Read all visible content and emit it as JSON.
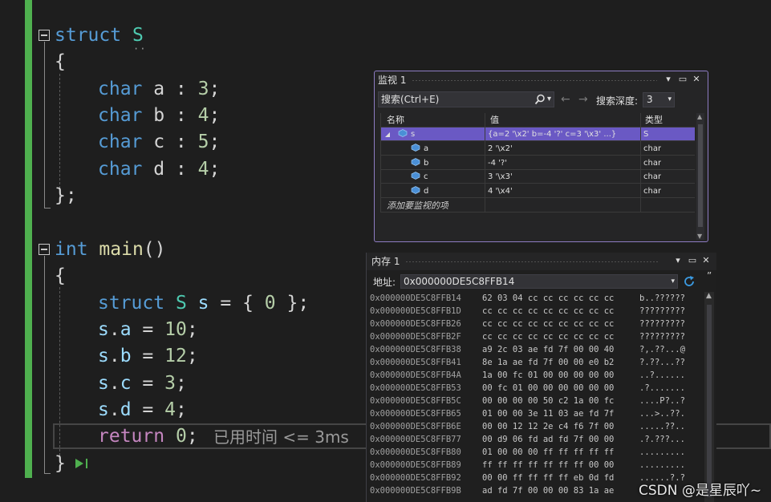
{
  "editor": {
    "lines": {
      "l1_kw": "struct",
      "l1_name": "S",
      "l2": "{",
      "l3_type": "char",
      "l3_rest": " a : ",
      "l3_num": "3",
      "l3_semi": ";",
      "l4_type": "char",
      "l4_rest": " b : ",
      "l4_num": "4",
      "l4_semi": ";",
      "l5_type": "char",
      "l5_rest": " c : ",
      "l5_num": "5",
      "l5_semi": ";",
      "l6_type": "char",
      "l6_rest": " d : ",
      "l6_num": "4",
      "l6_semi": ";",
      "l7": "};",
      "l8_kw": "int",
      "l8_fn": "main",
      "l8_rest": "()",
      "l9": "{",
      "l10_kw": "struct",
      "l10_ty": "S",
      "l10_var": "s",
      "l10_mid": " = { ",
      "l10_num": "0",
      "l10_end": " };",
      "l11_var": "s",
      "l11_dot": ".",
      "l11_mem": "a",
      "l11_eq": " = ",
      "l11_num": "10",
      "l11_semi": ";",
      "l12_var": "s",
      "l12_dot": ".",
      "l12_mem": "b",
      "l12_eq": " = ",
      "l12_num": "12",
      "l12_semi": ";",
      "l13_var": "s",
      "l13_dot": ".",
      "l13_mem": "c",
      "l13_eq": " = ",
      "l13_num": "3",
      "l13_semi": ";",
      "l14_var": "s",
      "l14_dot": ".",
      "l14_mem": "d",
      "l14_eq": " = ",
      "l14_num": "4",
      "l14_semi": ";",
      "l15_kw": "return",
      "l15_num": "0",
      "l15_semi": ";",
      "l16": "}"
    },
    "elapsed_text": "已用时间 <= 3ms",
    "colors": {
      "keyword": "#569cd6",
      "type": "#4ec9b0",
      "number": "#b5cea8",
      "return": "#c586c0",
      "change_bar": "#4fb04f"
    }
  },
  "watch": {
    "title": "监视 1",
    "search_placeholder": "搜索(Ctrl+E)",
    "depth_label": "搜索深度:",
    "depth_value": "3",
    "columns": {
      "name": "名称",
      "value": "值",
      "type": "类型"
    },
    "rows": [
      {
        "name": "s",
        "value": "{a=2 '\\x2' b=-4 '?' c=3 '\\x3' ...}",
        "type": "S"
      },
      {
        "name": "a",
        "value": "2 '\\x2'",
        "type": "char"
      },
      {
        "name": "b",
        "value": "-4 '?'",
        "type": "char"
      },
      {
        "name": "c",
        "value": "3 '\\x3'",
        "type": "char"
      },
      {
        "name": "d",
        "value": "4 '\\x4'",
        "type": "char"
      }
    ],
    "add_item": "添加要监视的项",
    "accent": "#6a59c4"
  },
  "memory": {
    "title": "内存 1",
    "address_label": "地址:",
    "address_value": "0x000000DE5C8FFB14",
    "rows": [
      {
        "addr": "0x000000DE5C8FFB14",
        "bytes": "62 03 04 cc cc cc cc cc cc",
        "ascii": "b..??????"
      },
      {
        "addr": "0x000000DE5C8FFB1D",
        "bytes": "cc cc cc cc cc cc cc cc cc",
        "ascii": "?????????"
      },
      {
        "addr": "0x000000DE5C8FFB26",
        "bytes": "cc cc cc cc cc cc cc cc cc",
        "ascii": "?????????"
      },
      {
        "addr": "0x000000DE5C8FFB2F",
        "bytes": "cc cc cc cc cc cc cc cc cc",
        "ascii": "?????????"
      },
      {
        "addr": "0x000000DE5C8FFB38",
        "bytes": "a9 2c 03 ae fd 7f 00 00 40",
        "ascii": "?,.??...@"
      },
      {
        "addr": "0x000000DE5C8FFB41",
        "bytes": "8e 1a ae fd 7f 00 00 e0 b2",
        "ascii": "?.??...??"
      },
      {
        "addr": "0x000000DE5C8FFB4A",
        "bytes": "1a 00 fc 01 00 00 00 00 00",
        "ascii": "..?......"
      },
      {
        "addr": "0x000000DE5C8FFB53",
        "bytes": "00 fc 01 00 00 00 00 00 00",
        "ascii": ".?......."
      },
      {
        "addr": "0x000000DE5C8FFB5C",
        "bytes": "00 00 00 00 50 c2 1a 00 fc",
        "ascii": "....P?..?"
      },
      {
        "addr": "0x000000DE5C8FFB65",
        "bytes": "01 00 00 3e 11 03 ae fd 7f",
        "ascii": "...>..??."
      },
      {
        "addr": "0x000000DE5C8FFB6E",
        "bytes": "00 00 12 12 2e c4 f6 7f 00",
        "ascii": ".....??.."
      },
      {
        "addr": "0x000000DE5C8FFB77",
        "bytes": "00 d9 06 fd ad fd 7f 00 00",
        "ascii": ".?.???..."
      },
      {
        "addr": "0x000000DE5C8FFB80",
        "bytes": "01 00 00 00 ff ff ff ff ff",
        "ascii": "........."
      },
      {
        "addr": "0x000000DE5C8FFB89",
        "bytes": "ff ff ff ff ff ff ff 00 00",
        "ascii": "........."
      },
      {
        "addr": "0x000000DE5C8FFB92",
        "bytes": "00 00 ff ff ff ff eb 0d fd",
        "ascii": "......?.?"
      },
      {
        "addr": "0x000000DE5C8FFB9B",
        "bytes": "ad fd 7f 00 00 00 83 1a ae",
        "ascii": ""
      }
    ]
  },
  "watermark": "CSDN @是星辰吖~"
}
